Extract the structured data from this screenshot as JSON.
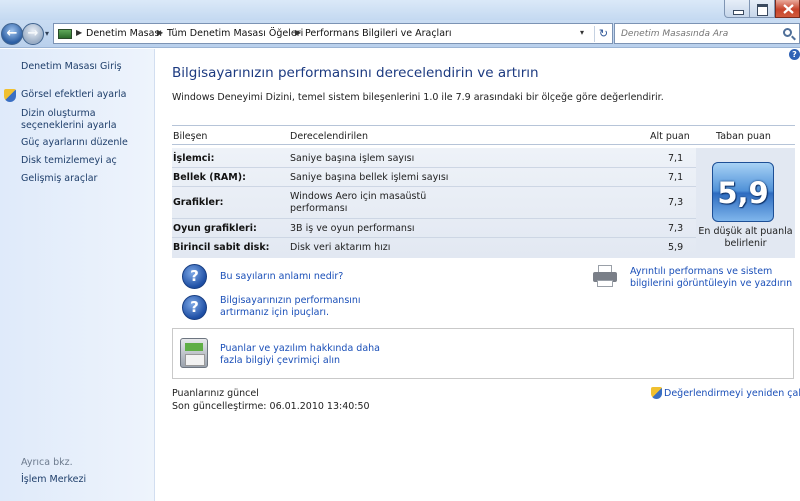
{
  "window": {
    "controls": {
      "minimize_icon": "minimize-icon",
      "maximize_icon": "maximize-icon",
      "close_icon": "close-icon"
    }
  },
  "nav": {
    "back_icon": "back-arrow-icon",
    "forward_icon": "forward-arrow-icon",
    "breadcrumbs": [
      "Denetim Masası",
      "Tüm Denetim Masası Öğeleri",
      "Performans Bilgileri ve Araçları"
    ],
    "search_placeholder": "Denetim Masasında Ara"
  },
  "sidebar": {
    "home_link": "Denetim Masası Giriş",
    "tasks": [
      "Görsel efektleri ayarla",
      "Dizin oluşturma seçeneklerini ayarla",
      "Güç ayarlarını düzenle",
      "Disk temizlemeyi aç",
      "Gelişmiş araçlar"
    ],
    "see_also_label": "Ayrıca bkz.",
    "see_also_links": [
      "İşlem Merkezi"
    ]
  },
  "main": {
    "title": "Bilgisayarınızın performansını derecelendirin ve artırın",
    "subtitle": "Windows Deneyimi Dizini, temel sistem bileşenlerini 1.0 ile 7.9 arasındaki bir ölçeğe göre değerlendirir.",
    "table": {
      "headers": {
        "component": "Bileşen",
        "rated": "Derecelendirilen",
        "subscore": "Alt puan",
        "base": "Taban puan"
      },
      "rows": [
        {
          "component": "İşlemci:",
          "description": "Saniye başına işlem sayısı",
          "subscore": "7,1"
        },
        {
          "component": "Bellek (RAM):",
          "description": "Saniye başına bellek işlemi sayısı",
          "subscore": "7,1"
        },
        {
          "component": "Grafikler:",
          "description": "Windows Aero için masaüstü performansı",
          "subscore": "7,3"
        },
        {
          "component": "Oyun grafikleri:",
          "description": "3B iş ve oyun performansı",
          "subscore": "7,3"
        },
        {
          "component": "Birincil sabit disk:",
          "description": "Disk veri aktarım hızı",
          "subscore": "5,9"
        }
      ],
      "base_score": "5,9",
      "base_caption": "En düşük alt puanla belirlenir"
    },
    "links": {
      "meaning": "Bu sayıların anlamı nedir?",
      "tips": "Bilgisayarınızın performansını artırmanız için ipuçları.",
      "print": "Ayrıntılı performans ve sistem bilgilerini görüntüleyin ve yazdırın",
      "online": "Puanlar ve yazılım hakkında daha fazla bilgiyi çevrimiçi alın"
    },
    "status": {
      "current": "Puanlarınız güncel",
      "last_update": "Son güncelleştirme: 06.01.2010 13:40:50",
      "rerun": "Değerlendirmeyi yeniden çalıştır"
    }
  }
}
